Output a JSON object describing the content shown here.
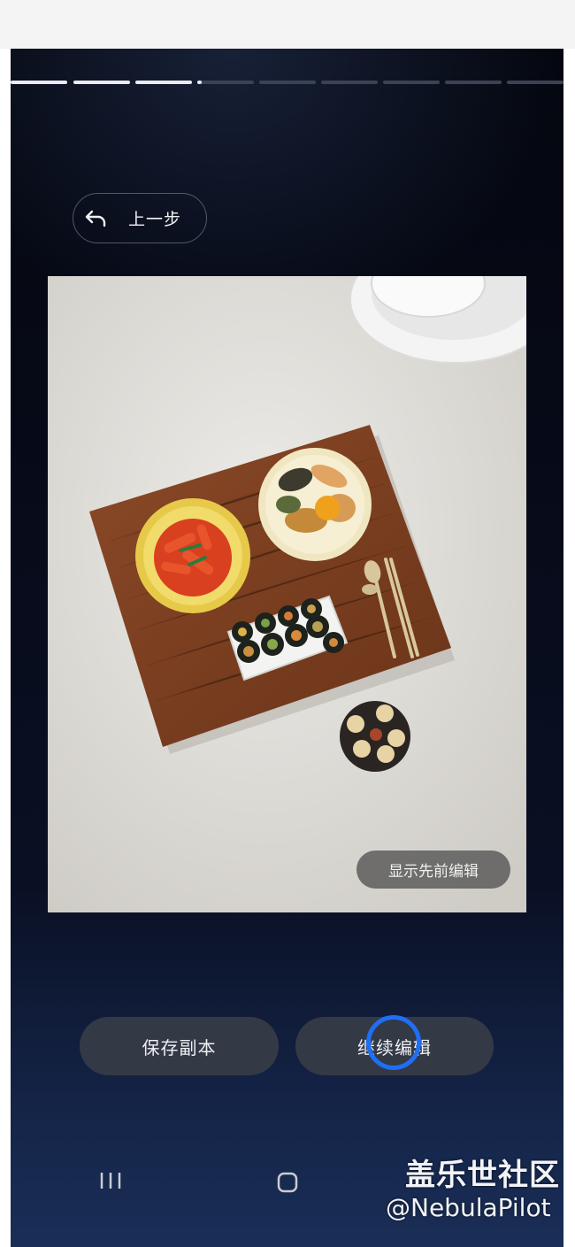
{
  "progress": {
    "total_steps": 9,
    "completed_steps": 3,
    "current_step_fraction": 0.08
  },
  "back_button": {
    "label": "上一步",
    "icon": "back-arrow-icon"
  },
  "photo": {
    "subject": "food-photo",
    "overlay_button_label": "显示先前编辑"
  },
  "actions": {
    "save_copy_label": "保存副本",
    "continue_edit_label": "继续编辑"
  },
  "nav": {
    "recent_icon": "recent-apps-icon",
    "home_icon": "home-icon"
  },
  "watermark": {
    "title": "盖乐世社区",
    "user": "@NebulaPilot"
  },
  "colors": {
    "accent": "#1e6ff5",
    "button_bg": "#343946",
    "background_top": "#04070f",
    "background_bottom": "#1a2e57"
  }
}
